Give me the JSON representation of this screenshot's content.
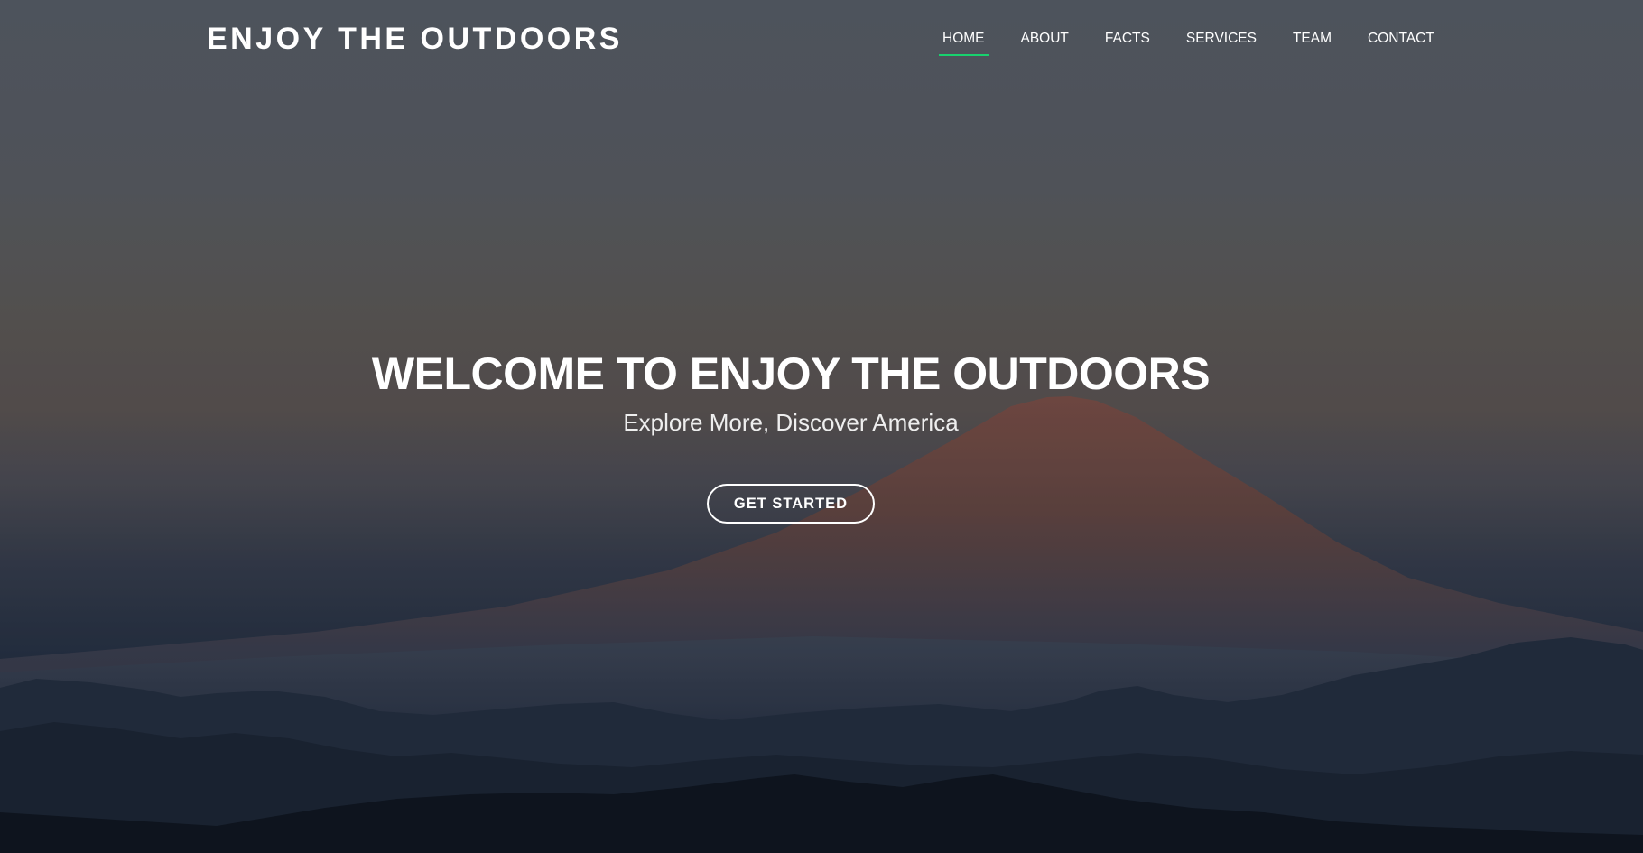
{
  "brand": {
    "logo_text": "ENJOY THE OUTDOORS"
  },
  "nav": {
    "items": [
      {
        "label": "HOME",
        "active": true
      },
      {
        "label": "ABOUT",
        "active": false
      },
      {
        "label": "FACTS",
        "active": false
      },
      {
        "label": "SERVICES",
        "active": false
      },
      {
        "label": "TEAM",
        "active": false
      },
      {
        "label": "CONTACT",
        "active": false
      }
    ]
  },
  "hero": {
    "title": "WELCOME TO ENJOY THE OUTDOORS",
    "subtitle": "Explore More, Discover America",
    "button_label": "GET STARTED",
    "background_image": "mountain-landscape-image"
  },
  "colors": {
    "accent": "#18d26e",
    "text": "#ffffff"
  }
}
